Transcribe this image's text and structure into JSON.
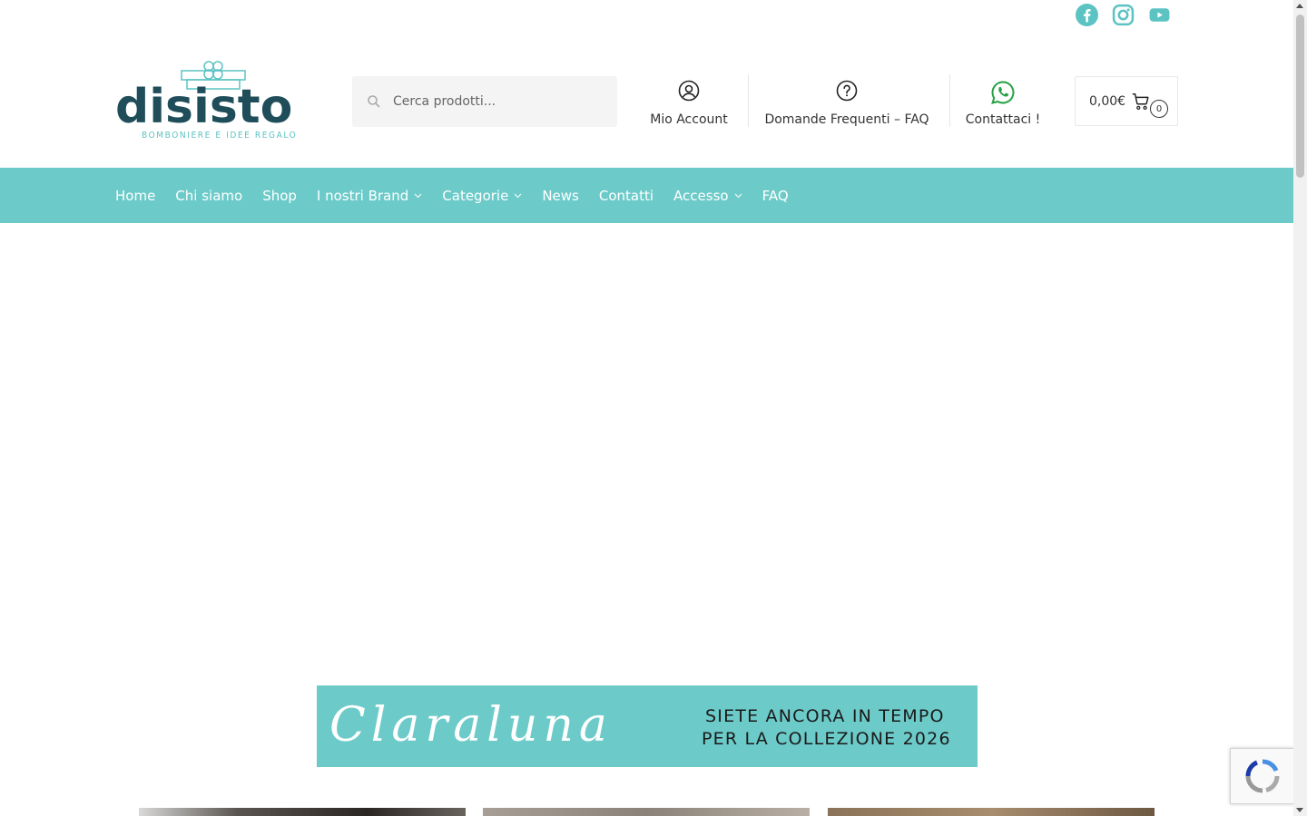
{
  "social": {
    "items": [
      "facebook-icon",
      "instagram-icon",
      "youtube-icon"
    ],
    "color": "#5cc3c3"
  },
  "logo": {
    "text": "disisto",
    "tagline": "BOMBONIERE E IDEE REGALO"
  },
  "search": {
    "placeholder": "Cerca prodotti..."
  },
  "header": {
    "account_label": "Mio Account",
    "faq_label": "Domande Frequenti – FAQ",
    "contact_label": "Contattaci !",
    "whatsapp_color": "#25a244"
  },
  "cart": {
    "amount": "0,00€",
    "count": "0"
  },
  "nav": {
    "background": "#6ccbc9",
    "items": [
      {
        "label": "Home"
      },
      {
        "label": "Chi siamo"
      },
      {
        "label": "Shop"
      },
      {
        "label": "I nostri Brand"
      },
      {
        "label": "Categorie"
      },
      {
        "label": "News"
      },
      {
        "label": "Contatti"
      },
      {
        "label": "Accesso"
      },
      {
        "label": "FAQ"
      }
    ]
  },
  "banner": {
    "brand": "Claraluna",
    "line1": "SIETE ANCORA IN TEMPO",
    "line2": "PER LA COLLEZIONE 2026"
  }
}
